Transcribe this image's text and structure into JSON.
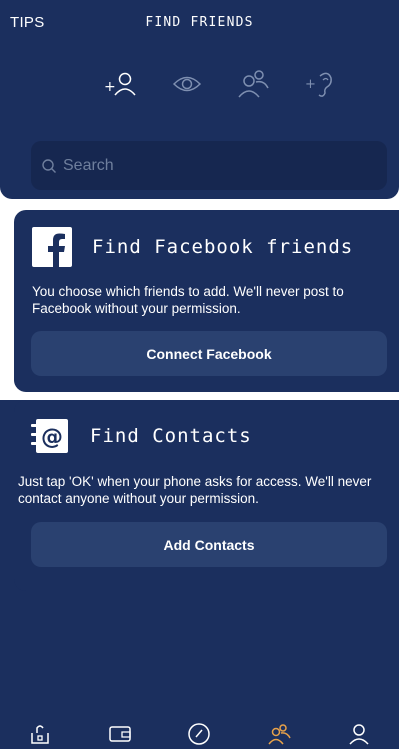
{
  "header": {
    "tips_label": "TIPS",
    "title": "FIND FRIENDS"
  },
  "tabs": [
    {
      "icon": "add-person-icon"
    },
    {
      "icon": "eye-icon"
    },
    {
      "icon": "people-icon"
    },
    {
      "icon": "add-ear-icon"
    }
  ],
  "search": {
    "placeholder": "Search"
  },
  "facebook_card": {
    "title": "Find Facebook friends",
    "description": "You choose which friends to add. We'll never post to Facebook without your permission.",
    "button_label": "Connect Facebook"
  },
  "contacts_card": {
    "title": "Find Contacts",
    "description": "Just tap 'OK' when your phone asks for access. We'll never contact anyone without your permission.",
    "button_label": "Add Contacts"
  },
  "bottom_nav": [
    {
      "icon": "home-icon"
    },
    {
      "icon": "wallet-icon"
    },
    {
      "icon": "speedometer-icon"
    },
    {
      "icon": "friends-icon",
      "active": true
    },
    {
      "icon": "profile-icon"
    }
  ],
  "colors": {
    "background": "#1b2f5e",
    "search_bg": "#162750",
    "button_bg": "#2a4170",
    "active_accent": "#e8a24a",
    "inactive_icon": "#7e8fb0"
  }
}
